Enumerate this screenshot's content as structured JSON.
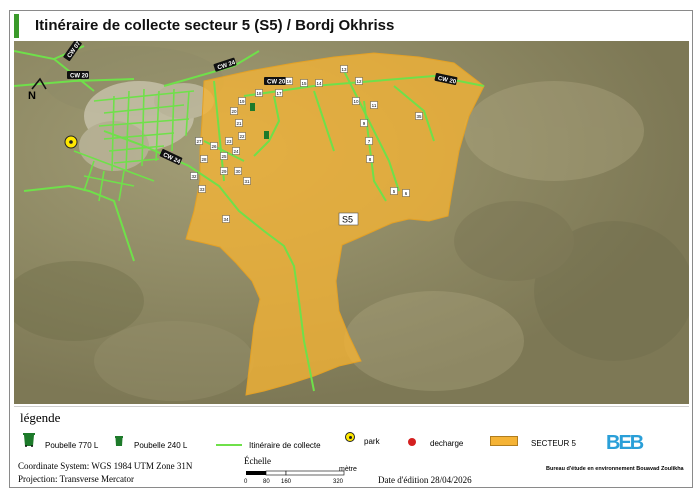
{
  "title": "Itinéraire de collecte secteur  5 (S5) / Bordj Okhriss",
  "map": {
    "north_label": "N",
    "sector_label": "S5",
    "road_labels": [
      "CW 20",
      "CW 24",
      "CW 20",
      "CW 24",
      "CW 20",
      "CW 07"
    ],
    "bin_numbers": [
      "5",
      "6",
      "7",
      "8",
      "9",
      "10",
      "11",
      "12",
      "13",
      "14",
      "15",
      "16",
      "17",
      "18",
      "19",
      "20",
      "21",
      "22",
      "23",
      "24",
      "25",
      "26",
      "27",
      "28",
      "29",
      "30",
      "31",
      "32",
      "33",
      "34",
      "35"
    ]
  },
  "legend": {
    "title": "légende",
    "bin770": "Poubelle 770 L",
    "bin240": "Poubelle 240 L",
    "route": "Itinéraire de collecte",
    "park": "park",
    "decharge": "decharge",
    "sector": "SECTEUR 5",
    "coord_system": "Coordinate System: WGS 1984 UTM Zone 31N",
    "projection": "Projection: Transverse Mercator",
    "scale_title": "Échelle",
    "scale_ticks": [
      "0",
      "80",
      "160",
      "320"
    ],
    "scale_unit": "mètre",
    "edition_date": "Date d'édition 28/04/2026",
    "bureau": "Bureau d'étude en environnement Bouavad Zoulikha",
    "logo_text": "BEB"
  },
  "colors": {
    "sector_fill": "#f5b335",
    "route": "#6fe04a",
    "park": "#ffe800",
    "decharge": "#d42020",
    "bin": "#1d7a2a",
    "terrain": "#8f8a63"
  }
}
